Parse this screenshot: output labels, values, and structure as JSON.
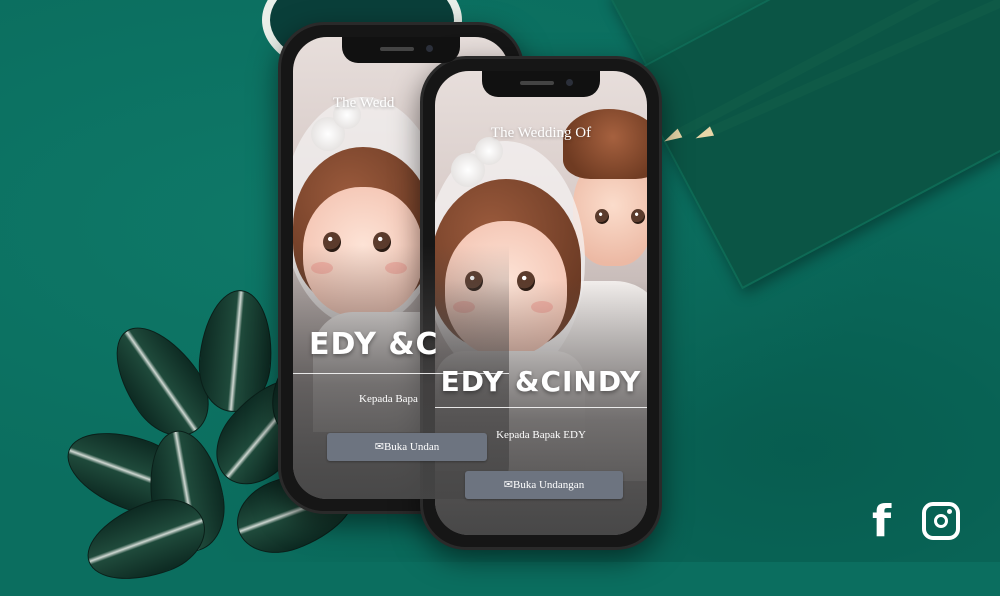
{
  "invitation": {
    "heading": "The Wedding Of",
    "couple": "EDY &CINDY",
    "recipient": "Kepada Bapak EDY",
    "open_button": "Buka Undangan",
    "open_button_icon": "envelope-icon"
  },
  "back_phone": {
    "heading": "The Wedd",
    "couple": "EDY &C",
    "recipient": "Kepada Bapa",
    "open_button": "Buka Undan"
  },
  "social": {
    "facebook_icon": "facebook-icon",
    "instagram_icon": "instagram-icon"
  },
  "colors": {
    "background": "#0b6e5f",
    "button": "#6d7480"
  }
}
